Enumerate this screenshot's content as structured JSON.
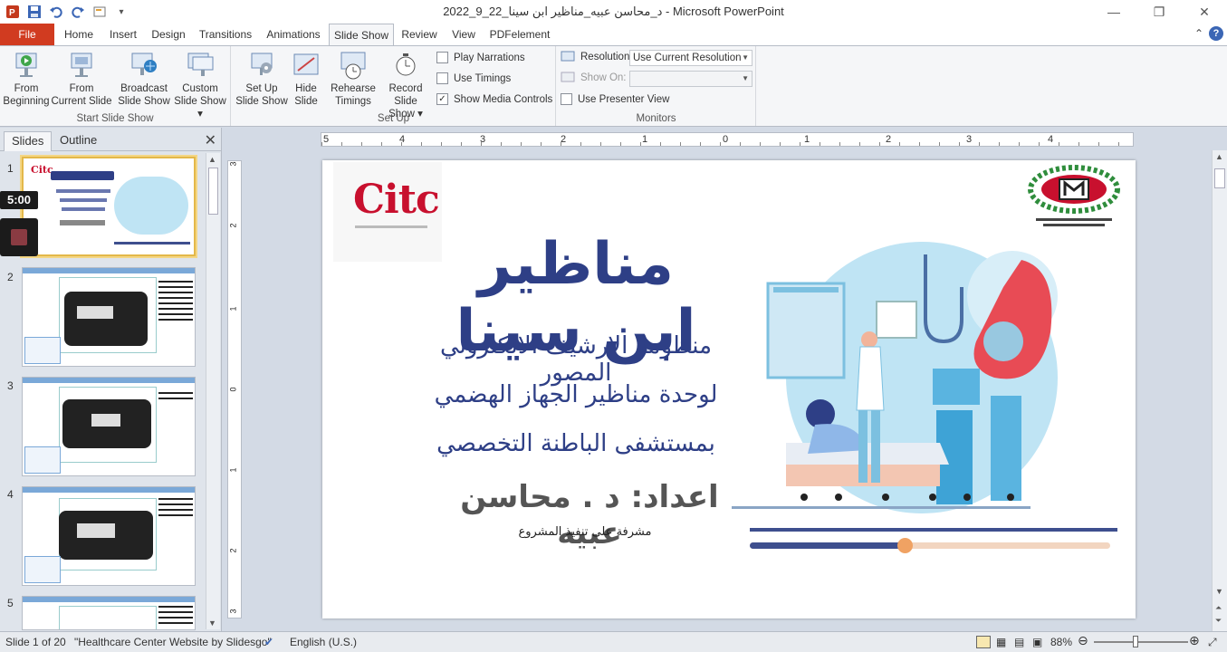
{
  "window": {
    "title": "2022_9_22_د_محاسن عبيه_مناظير ابن سينا - Microsoft PowerPoint"
  },
  "tabs": [
    "File",
    "Home",
    "Insert",
    "Design",
    "Transitions",
    "Animations",
    "Slide Show",
    "Review",
    "View",
    "PDFelement"
  ],
  "active_tab": "Slide Show",
  "ribbon": {
    "start_group": {
      "label": "Start Slide Show",
      "from_beginning": [
        "From",
        "Beginning"
      ],
      "from_current": [
        "From",
        "Current Slide"
      ],
      "broadcast": [
        "Broadcast",
        "Slide Show"
      ],
      "custom": [
        "Custom",
        "Slide Show ▾"
      ]
    },
    "setup_group": {
      "label": "Set Up",
      "setup": [
        "Set Up",
        "Slide Show"
      ],
      "hide": [
        "Hide",
        "Slide"
      ],
      "rehearse": [
        "Rehearse",
        "Timings"
      ],
      "record": [
        "Record Slide",
        "Show ▾"
      ],
      "play_narrations": "Play Narrations",
      "use_timings": "Use Timings",
      "show_media_controls": "Show Media Controls",
      "checks": {
        "play_narrations": false,
        "use_timings": false,
        "show_media_controls": true
      }
    },
    "monitors_group": {
      "label": "Monitors",
      "resolution_label": "Resolution:",
      "resolution_value": "Use Current Resolution",
      "show_on_label": "Show On:",
      "show_on_value": "",
      "presenter_view": "Use Presenter View",
      "presenter_checked": false
    }
  },
  "left_pane": {
    "tab_slides": "Slides",
    "tab_outline": "Outline",
    "slide_numbers": [
      "1",
      "2",
      "3",
      "4",
      "5"
    ],
    "timer": "5:00"
  },
  "ruler": {
    "h_labels": [
      "5",
      "4",
      "3",
      "2",
      "1",
      "0",
      "1",
      "2",
      "3",
      "4"
    ],
    "v_labels": [
      "3",
      "2",
      "1",
      "0",
      "1",
      "2",
      "3"
    ]
  },
  "slide": {
    "logo_text": "Citc",
    "title": "مناظير ابن سينا",
    "line1": "منظومة الارشيف الالكتروني المصور",
    "line2": "لوحدة مناظير الجهاز الهضمي",
    "line3": "بمستشفى الباطنة التخصصي",
    "author": "اعداد: د . محاسن عبيه",
    "supervisor": "مشرفة على تنفيذ المشروع",
    "progress": 0.43
  },
  "statusbar": {
    "slide_info": "Slide 1 of 20",
    "theme": "\"Healthcare Center Website by Slidesgo\"",
    "language": "English (U.S.)",
    "zoom": "88%",
    "zoom_fraction": 0.44
  },
  "colors": {
    "file_tab": "#d13b20",
    "title_blue": "#2e3f86",
    "logo_red": "#c8102e",
    "progress_orange": "#f0a263"
  }
}
